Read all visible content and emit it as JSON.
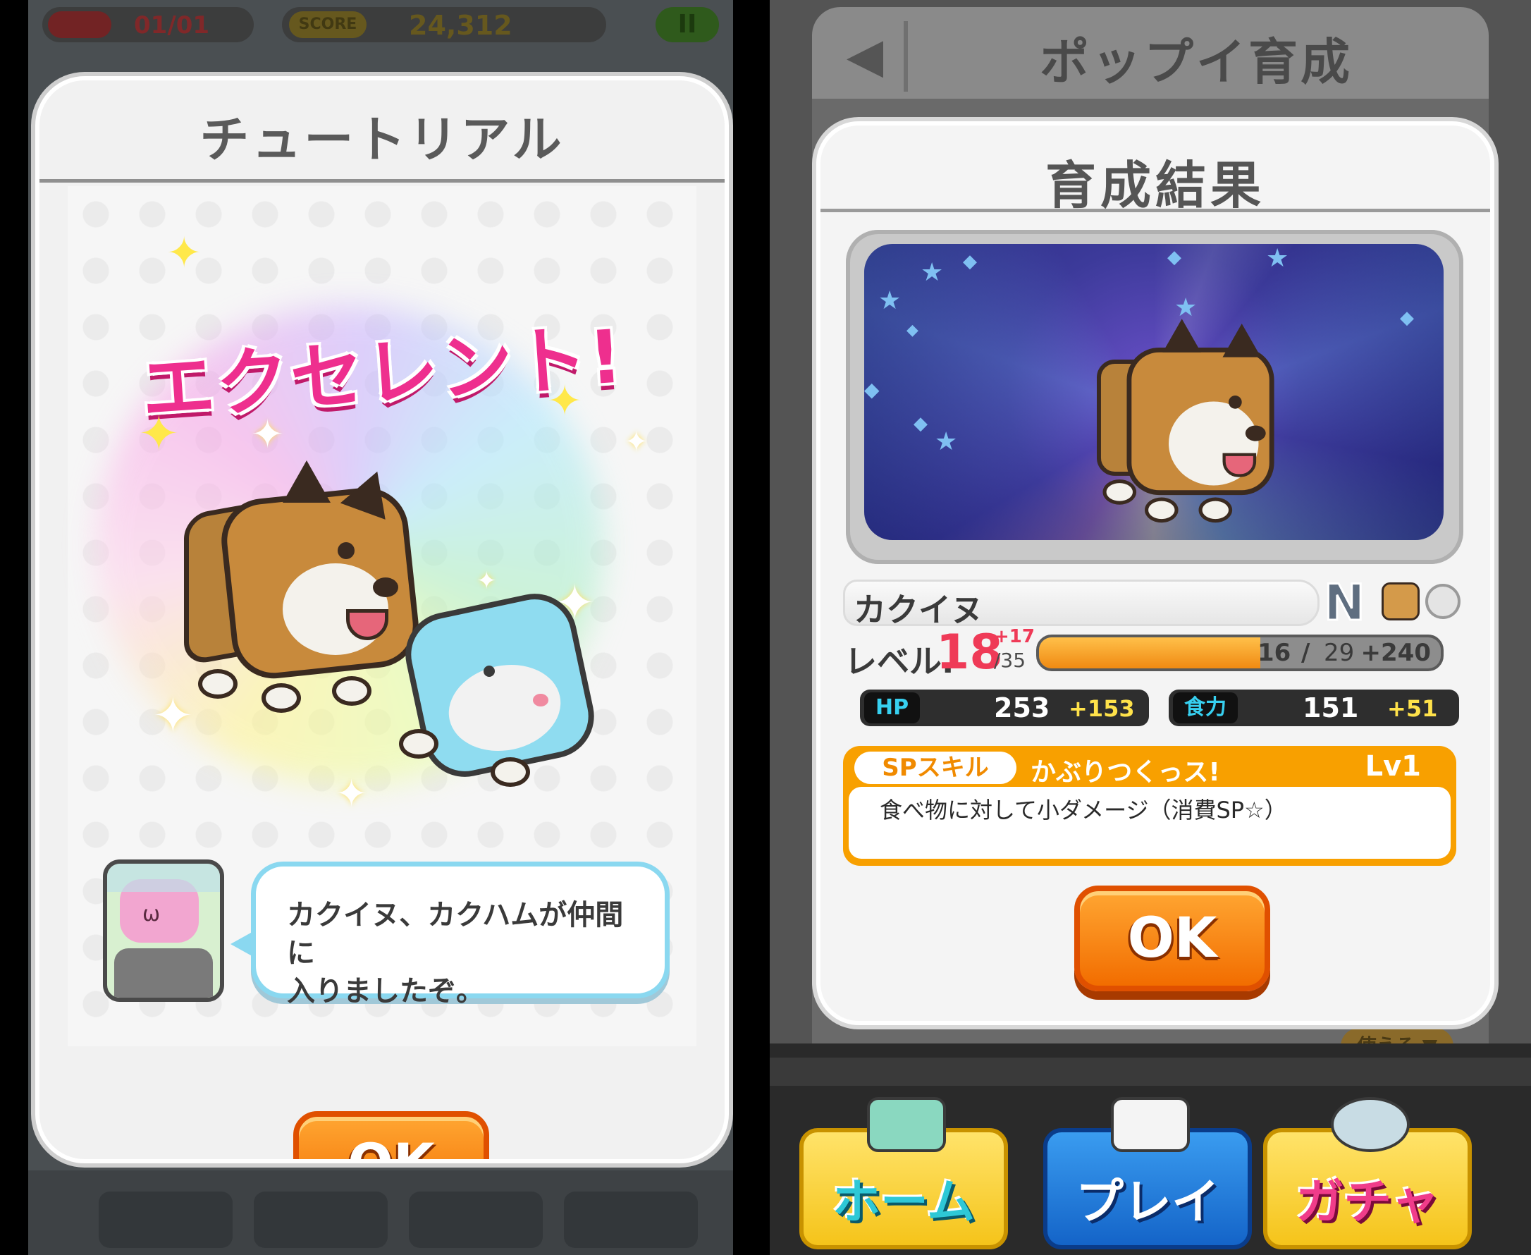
{
  "left": {
    "hud": {
      "lives": "01/01",
      "score_label": "SCORE",
      "score": "24,312",
      "pause_glyph": "II"
    },
    "dialog": {
      "title": "チュートリアル",
      "headline": "エクセレント!",
      "message": "カクイヌ、カクハムが仲間に\n入りましたぞ。",
      "ok_label": "OK"
    }
  },
  "right": {
    "header": {
      "back_icon": "◀",
      "title": "ポップイ育成"
    },
    "dialog": {
      "title": "育成結果",
      "character": {
        "name": "カクイヌ",
        "rarity": "N",
        "level_label": "レベル.",
        "level": "18",
        "level_gain": "+17",
        "level_max": "/35",
        "exp_current": "16",
        "exp_required": "29",
        "exp_gain": "+240",
        "exp_progress": 0.55
      },
      "stats": [
        {
          "label": "HP",
          "value": "253",
          "gain": "+153"
        },
        {
          "label": "食力",
          "value": "151",
          "gain": "+51"
        }
      ],
      "skill": {
        "tag": "SPスキル",
        "name": "かぶりつくっス!",
        "level": "Lv1",
        "description": "食べ物に対して小ダメージ（消費SP☆）"
      },
      "ok_label": "OK"
    },
    "behind_pill": "使える ▼",
    "nav": [
      {
        "label": "ホーム"
      },
      {
        "label": "プレイ"
      },
      {
        "label": "ガチャ"
      }
    ]
  },
  "colors": {
    "accent_orange": "#f26d00",
    "headline_pink": "#ee2f8e",
    "level_red": "#ef3a57",
    "gain_yellow": "#ffe24a"
  }
}
